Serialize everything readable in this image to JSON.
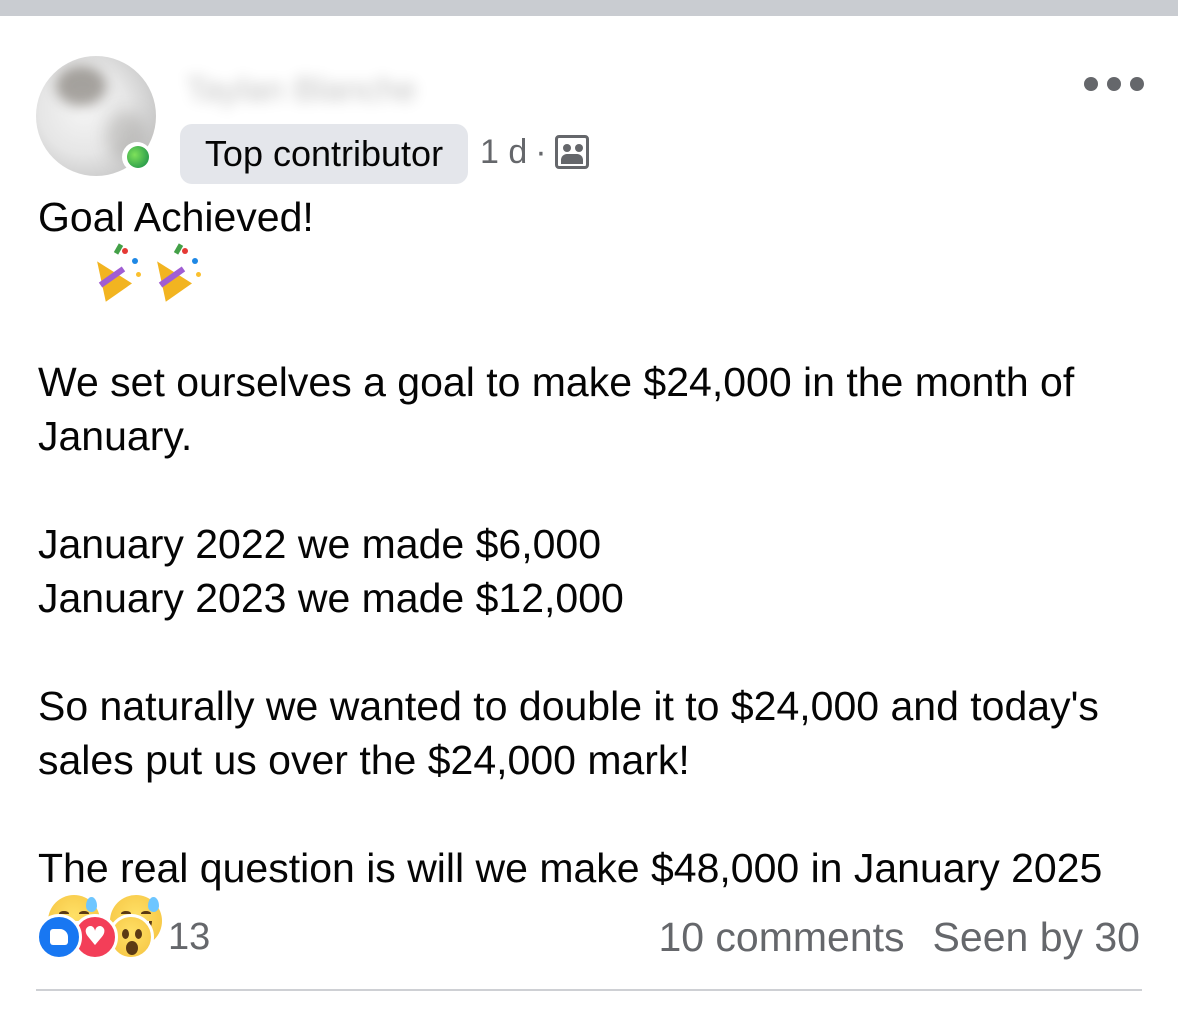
{
  "post": {
    "author": {
      "name": "Taylan Blanche",
      "badge": "Top contributor"
    },
    "meta": {
      "time": "1 d",
      "separator": "·",
      "audience_icon": "group-icon"
    },
    "more_icon": "more-horizontal-icon",
    "body": {
      "line1": "Goal Achieved!",
      "emoji_party": "party-popper",
      "para2": "We set ourselves a goal to make $24,000 in the month of January.",
      "para3a": "January 2022 we made $6,000",
      "para3b": "January 2023 we made $12,000",
      "para4": "So naturally we wanted to double it to $24,000 and today's sales put us over the $24,000 mark!",
      "para5": "The real question is will we make $48,000 in January 2025",
      "emoji_sweat": "grinning-face-with-sweat"
    },
    "footer": {
      "reaction_types": [
        "like",
        "love",
        "wow"
      ],
      "reaction_count": "13",
      "comments": "10 comments",
      "seen": "Seen by 30"
    },
    "colors": {
      "text": "#050505",
      "secondary": "#65676b",
      "badge_bg": "#e4e6eb",
      "like": "#1877f2",
      "love": "#f33e58",
      "online": "#31a24c"
    }
  }
}
